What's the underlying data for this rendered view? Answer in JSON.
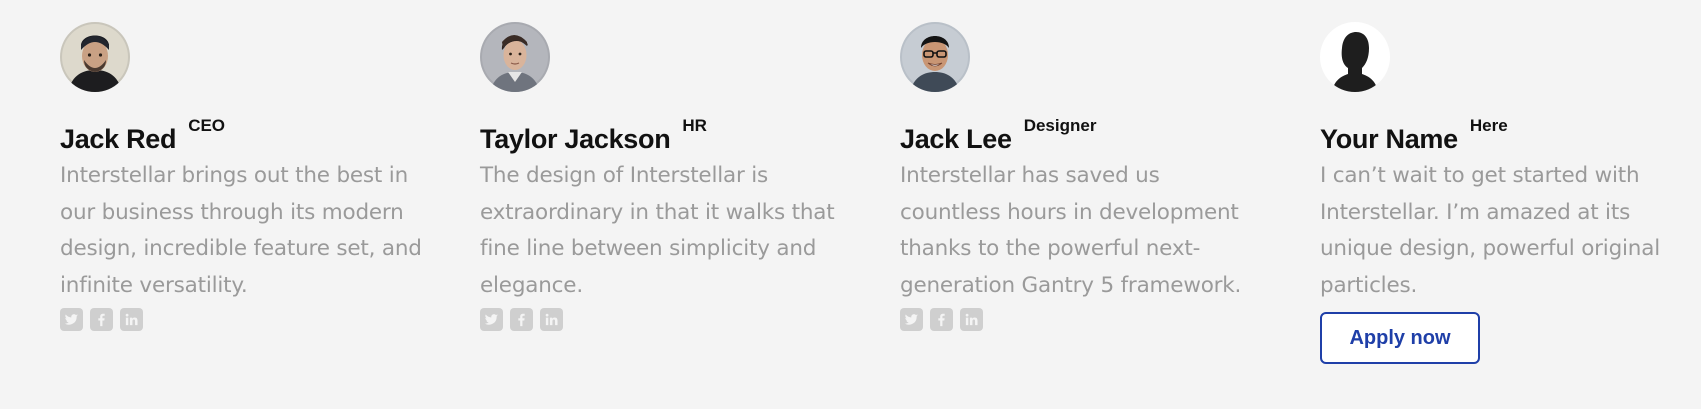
{
  "members": [
    {
      "name": "Jack Red",
      "role": "CEO",
      "quote": "Interstellar brings out the best in our business through its modern design, incredible feature set, and infinite versatility.",
      "social": [
        "twitter-icon",
        "facebook-icon",
        "linkedin-icon"
      ]
    },
    {
      "name": "Taylor Jackson",
      "role": "HR",
      "quote": "The design of Interstellar is extraordinary in that it walks that fine line between simplicity and elegance.",
      "social": [
        "twitter-icon",
        "facebook-icon",
        "linkedin-icon"
      ]
    },
    {
      "name": "Jack Lee",
      "role": "Designer",
      "quote": "Interstellar has saved us countless hours in development thanks to the powerful next-generation Gantry 5 framework.",
      "social": [
        "twitter-icon",
        "facebook-icon",
        "linkedin-icon"
      ]
    },
    {
      "name": "Your Name",
      "role": "Here",
      "quote": "I can’t wait to get started with Interstellar. I’m amazed at its unique design, powerful original particles.",
      "button": "Apply now"
    }
  ],
  "colors": {
    "background": "#f4f4f4",
    "name_text": "#111111",
    "quote_text": "#9a9a9a",
    "social_icon_bg": "#cfcfcf",
    "accent": "#1f3fa8"
  }
}
